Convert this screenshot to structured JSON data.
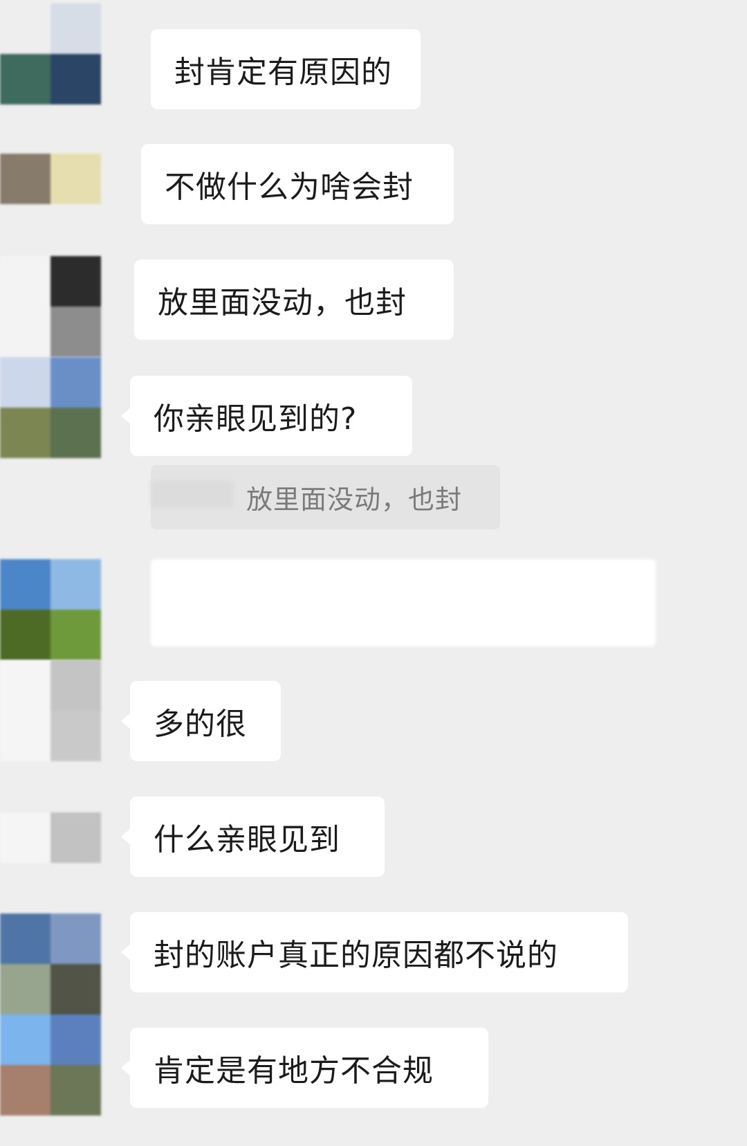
{
  "messages": [
    {
      "text": "封肯定有原因的"
    },
    {
      "text": "不做什么为啥会封"
    },
    {
      "text": "放里面没动，也封"
    },
    {
      "text": "你亲眼见到的?"
    },
    {
      "text": "多的很"
    },
    {
      "text": "什么亲眼见到"
    },
    {
      "text": "封的账户真正的原因都不说的"
    },
    {
      "text": "肯定是有地方不合规"
    }
  ],
  "quote": {
    "text": "放里面没动，也封"
  },
  "colors": {
    "background": "#eeeeee",
    "bubble": "#ffffff",
    "quote_background": "#e4e4e4",
    "quote_text": "#7a7a7a"
  }
}
